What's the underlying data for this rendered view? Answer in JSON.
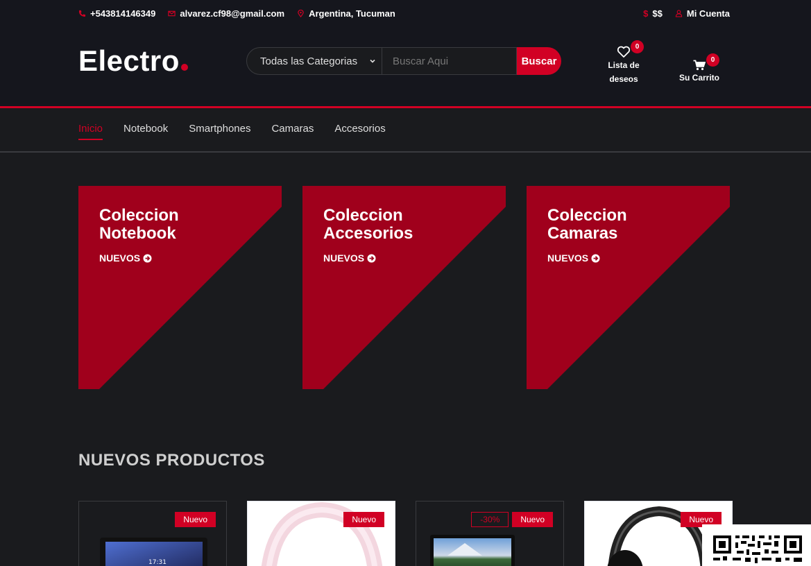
{
  "topbar": {
    "phone": "+543814146349",
    "email": "alvarez.cf98@gmail.com",
    "location": "Argentina, Tucuman",
    "currency": "$$",
    "account": "Mi Cuenta"
  },
  "header": {
    "logo": "Electro",
    "category_select": "Todas las Categorias",
    "search_placeholder": "Buscar Aqui",
    "search_button": "Buscar",
    "wishlist_label": "Lista de deseos",
    "wishlist_count": "0",
    "cart_label": "Su Carrito",
    "cart_count": "0"
  },
  "nav": {
    "items": [
      "Inicio",
      "Notebook",
      "Smartphones",
      "Camaras",
      "Accesorios"
    ]
  },
  "collections": [
    {
      "line1": "Coleccion",
      "line2": "Notebook",
      "cta": "NUEVOS"
    },
    {
      "line1": "Coleccion",
      "line2": "Accesorios",
      "cta": "NUEVOS"
    },
    {
      "line1": "Coleccion",
      "line2": "Camaras",
      "cta": "NUEVOS"
    }
  ],
  "section_title": "NUEVOS PRODUCTOS",
  "products": [
    {
      "label_new": "Nuevo"
    },
    {
      "label_new": "Nuevo"
    },
    {
      "label_sale": "-30%",
      "label_new": "Nuevo"
    },
    {
      "label_new": "Nuevo"
    }
  ],
  "colors": {
    "accent": "#d10024",
    "background": "#1a1b1e",
    "header": "#15161d"
  }
}
